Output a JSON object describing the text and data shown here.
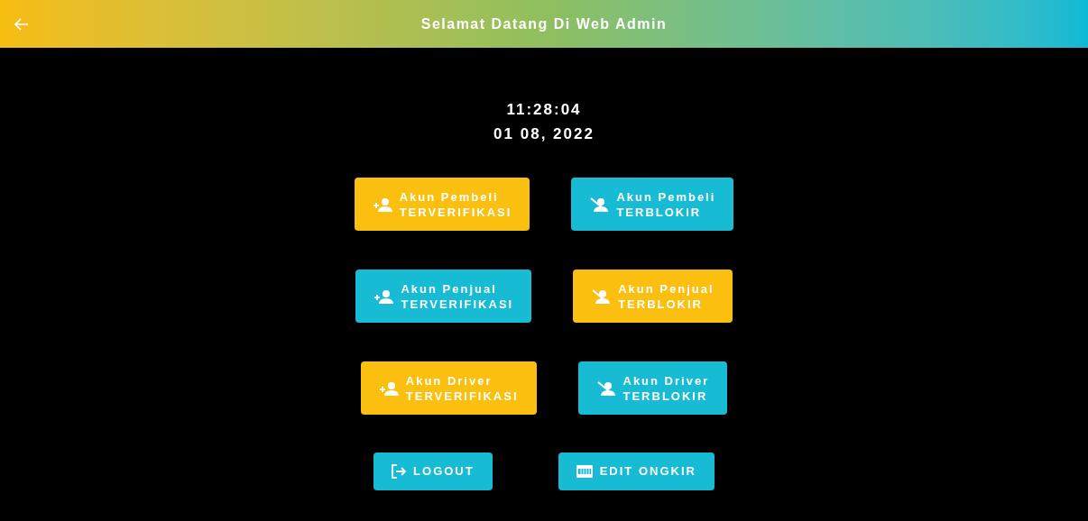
{
  "header": {
    "title": "Selamat Datang Di Web Admin"
  },
  "clock": {
    "time": "11:28:04",
    "date": "01 08, 2022"
  },
  "account_rows": [
    [
      {
        "kind": "verified",
        "line1": "Akun Pembeli",
        "line2": "TERVERIFIKASI",
        "color": "#fbbf10"
      },
      {
        "kind": "blocked",
        "line1": "Akun Pembeli",
        "line2": "TERBLOKIR",
        "color": "#17bcd4"
      }
    ],
    [
      {
        "kind": "verified",
        "line1": "Akun Penjual",
        "line2": "TERVERIFIKASI",
        "color": "#17bcd4"
      },
      {
        "kind": "blocked",
        "line1": "Akun Penjual",
        "line2": "TERBLOKIR",
        "color": "#fbbf10"
      }
    ],
    [
      {
        "kind": "verified",
        "line1": "Akun Driver",
        "line2": "TERVERIFIKASI",
        "color": "#fbbf10"
      },
      {
        "kind": "blocked",
        "line1": "Akun Driver",
        "line2": "TERBLOKIR",
        "color": "#17bcd4"
      }
    ]
  ],
  "actions": [
    {
      "kind": "logout",
      "label": "LOGOUT"
    },
    {
      "kind": "edit",
      "label": "EDIT ONGKIR"
    }
  ]
}
